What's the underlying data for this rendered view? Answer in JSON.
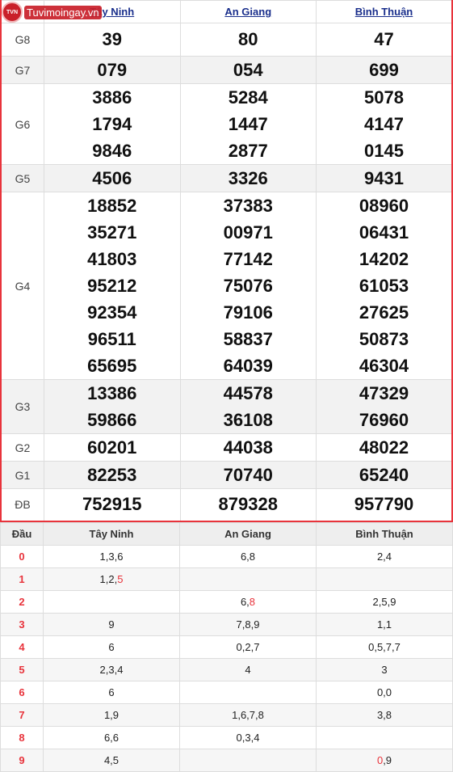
{
  "logo": {
    "badge": "TVN",
    "text": "Tuvimoingay.vn"
  },
  "provinces": [
    "Tây Ninh",
    "An Giang",
    "Bình Thuận"
  ],
  "prizes": {
    "g8": {
      "label": "G8",
      "values": [
        "39",
        "80",
        "47"
      ]
    },
    "g7": {
      "label": "G7",
      "values": [
        "079",
        "054",
        "699"
      ]
    },
    "g6": {
      "label": "G6",
      "values": [
        [
          "3886",
          "1794",
          "9846"
        ],
        [
          "5284",
          "1447",
          "2877"
        ],
        [
          "5078",
          "4147",
          "0145"
        ]
      ]
    },
    "g5": {
      "label": "G5",
      "values": [
        "4506",
        "3326",
        "9431"
      ]
    },
    "g4": {
      "label": "G4",
      "values": [
        [
          "18852",
          "35271",
          "41803",
          "95212",
          "92354",
          "96511",
          "65695"
        ],
        [
          "37383",
          "00971",
          "77142",
          "75076",
          "79106",
          "58837",
          "64039"
        ],
        [
          "08960",
          "06431",
          "14202",
          "61053",
          "27625",
          "50873",
          "46304"
        ]
      ]
    },
    "g3": {
      "label": "G3",
      "values": [
        [
          "13386",
          "59866"
        ],
        [
          "44578",
          "36108"
        ],
        [
          "47329",
          "76960"
        ]
      ]
    },
    "g2": {
      "label": "G2",
      "values": [
        "60201",
        "44038",
        "48022"
      ]
    },
    "g1": {
      "label": "G1",
      "values": [
        "82253",
        "70740",
        "65240"
      ]
    },
    "db": {
      "label": "ĐB",
      "values": [
        "752915",
        "879328",
        "957790"
      ]
    }
  },
  "loto": {
    "header": "Đầu",
    "rows": [
      {
        "d": "0",
        "cells": [
          [
            "1,3,6"
          ],
          [
            "6,8"
          ],
          [
            "2,4"
          ]
        ]
      },
      {
        "d": "1",
        "cells": [
          [
            "1,2,",
            "5"
          ],
          [
            ""
          ],
          [
            ""
          ]
        ]
      },
      {
        "d": "2",
        "cells": [
          [
            ""
          ],
          [
            "6,",
            "8"
          ],
          [
            "2,5,9"
          ]
        ]
      },
      {
        "d": "3",
        "cells": [
          [
            "9"
          ],
          [
            "7,8,9"
          ],
          [
            "1,1"
          ]
        ]
      },
      {
        "d": "4",
        "cells": [
          [
            "6"
          ],
          [
            "0,2,7"
          ],
          [
            "0,5,7,7"
          ]
        ]
      },
      {
        "d": "5",
        "cells": [
          [
            "2,3,4"
          ],
          [
            "4"
          ],
          [
            "3"
          ]
        ]
      },
      {
        "d": "6",
        "cells": [
          [
            "6"
          ],
          [
            ""
          ],
          [
            "0,0"
          ]
        ]
      },
      {
        "d": "7",
        "cells": [
          [
            "1,9"
          ],
          [
            "1,6,7,8"
          ],
          [
            "3,8"
          ]
        ]
      },
      {
        "d": "8",
        "cells": [
          [
            "6,6"
          ],
          [
            "0,3,4"
          ],
          [
            ""
          ]
        ]
      },
      {
        "d": "9",
        "cells": [
          [
            "4,5"
          ],
          [
            ""
          ],
          [
            "",
            "0",
            ",9"
          ]
        ]
      }
    ]
  },
  "colors": {
    "accent_red": "#e8333b",
    "link_blue": "#1a2f8c"
  }
}
